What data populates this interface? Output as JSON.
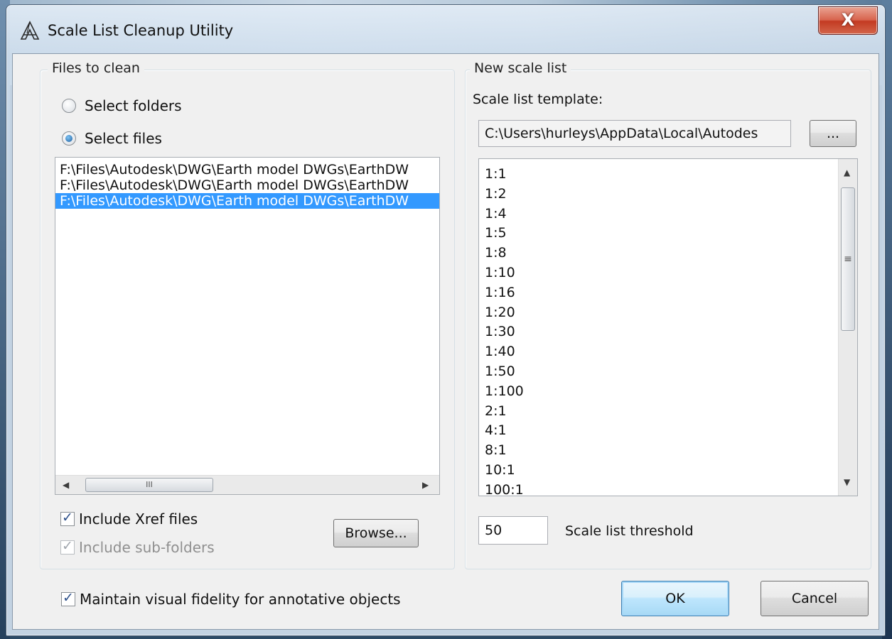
{
  "window": {
    "title": "Scale List Cleanup Utility",
    "close_label": "X"
  },
  "files_group": {
    "legend": "Files to clean",
    "radio_folders": "Select folders",
    "radio_files": "Select files",
    "selected_radio": "files",
    "files": [
      "F:\\Files\\Autodesk\\DWG\\Earth model DWGs\\EarthDW",
      "F:\\Files\\Autodesk\\DWG\\Earth model DWGs\\EarthDW",
      "F:\\Files\\Autodesk\\DWG\\Earth model DWGs\\EarthDW"
    ],
    "selected_file_index": 2,
    "include_xref_label": "Include Xref files",
    "include_xref_checked": true,
    "include_subfolders_label": "Include sub-folders",
    "include_subfolders_checked": true,
    "include_subfolders_enabled": false,
    "browse_label": "Browse..."
  },
  "scale_group": {
    "legend": "New scale list",
    "template_label": "Scale list template:",
    "template_path": "C:\\Users\\hurleys\\AppData\\Local\\Autodes",
    "template_browse_label": "...",
    "scales": [
      "1:1",
      "1:2",
      "1:4",
      "1:5",
      "1:8",
      "1:10",
      "1:16",
      "1:20",
      "1:30",
      "1:40",
      "1:50",
      "1:100",
      "2:1",
      "4:1",
      "8:1",
      "10:1",
      "100:1"
    ],
    "threshold_value": "50",
    "threshold_label": "Scale list threshold"
  },
  "footer": {
    "maintain_label": "Maintain visual fidelity for annotative objects",
    "maintain_checked": true,
    "ok_label": "OK",
    "cancel_label": "Cancel"
  },
  "icons": {
    "app": "autocad-a-icon",
    "close": "close-icon",
    "scroll_left": "arrow-left-icon",
    "scroll_right": "arrow-right-icon",
    "scroll_up": "arrow-up-icon",
    "scroll_down": "arrow-down-icon"
  }
}
